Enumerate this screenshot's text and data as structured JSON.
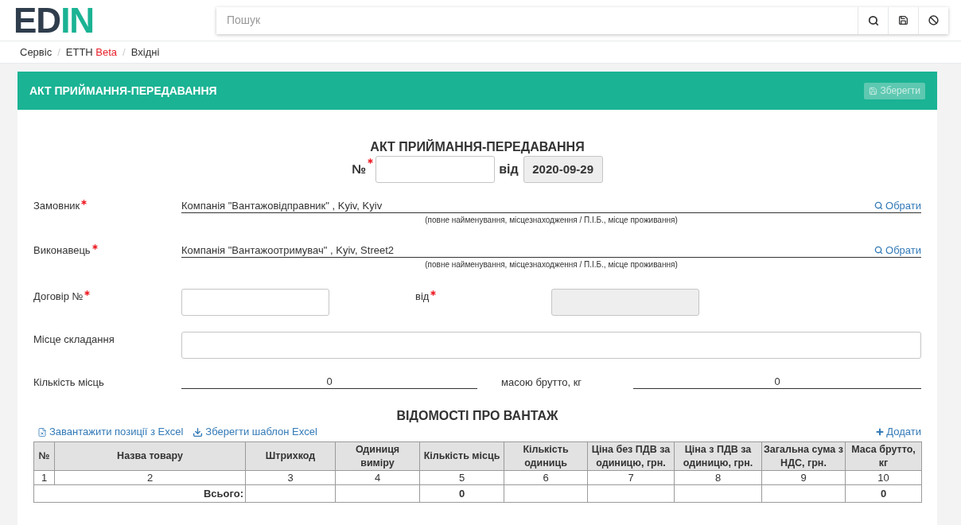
{
  "header": {
    "logo": {
      "dark": "ED",
      "accent": "IN"
    },
    "search": {
      "placeholder": "Пошук"
    }
  },
  "breadcrumb": {
    "separator": "/",
    "items": [
      {
        "label": "Сервіс"
      },
      {
        "label": "ЕТТН",
        "tag": "Beta"
      },
      {
        "label": "Вхідні"
      }
    ]
  },
  "panel": {
    "title": "АКТ ПРИЙМАННЯ-ПЕРЕДАВАННЯ",
    "save_button": {
      "label": "Зберегти",
      "disabled": true
    }
  },
  "document": {
    "title": "АКТ ПРИЙМАННЯ-ПЕРЕДАВАННЯ",
    "number": {
      "label": "№",
      "required": true,
      "disabled": false
    },
    "date": {
      "label": "від",
      "value": "2020-09-29",
      "disabled": true
    },
    "parties": [
      {
        "label": "Замовник",
        "required": true,
        "value": "Компанія \"Вантажовідправник\" , Kyiv, Kyiv",
        "action": "Обрати",
        "hint": "(повне найменування, місцезнаходження / П.І.Б., місце проживання)"
      },
      {
        "label": "Виконавець",
        "required": true,
        "value": "Компанія \"Вантажоотримувач\" , Kyiv, Street2",
        "action": "Обрати",
        "hint": "(повне найменування, місцезнаходження / П.І.Б., місце проживання)"
      }
    ],
    "contract": {
      "number": {
        "label": "Договір №",
        "required": true,
        "disabled": false
      },
      "date": {
        "label": "від",
        "required": true,
        "disabled": true
      }
    },
    "place": {
      "label": "Місце складання",
      "disabled": false
    },
    "places_count": {
      "label": "Кількість місць",
      "value": "0"
    },
    "gross_weight": {
      "label": "масою брутто, кг",
      "value": "0"
    }
  },
  "cargo": {
    "title": "ВІДОМОСТІ ПРО ВАНТАЖ",
    "links": [
      {
        "label": "Завантажити позиції з Excel",
        "kind": "upload"
      },
      {
        "label": "Зберегти шаблон Excel",
        "kind": "download"
      }
    ],
    "add_link": "Додати",
    "table": {
      "columns": [
        "№",
        "Назва товару",
        "Штрихкод",
        "Одиниця виміру",
        "Кількість місць",
        "Кількість одиниць",
        "Ціна без ПДВ за одиницю, грн.",
        "Ціна з ПДВ за одиницю, грн.",
        "Загальна сума з НДС, грн.",
        "Маса брутто, кг"
      ],
      "rows": [
        [
          "1",
          "2",
          "3",
          "4",
          "5",
          "6",
          "7",
          "8",
          "9",
          "10"
        ]
      ],
      "total": {
        "label": "Всього:",
        "places": "0",
        "gross_weight": "0"
      }
    }
  }
}
